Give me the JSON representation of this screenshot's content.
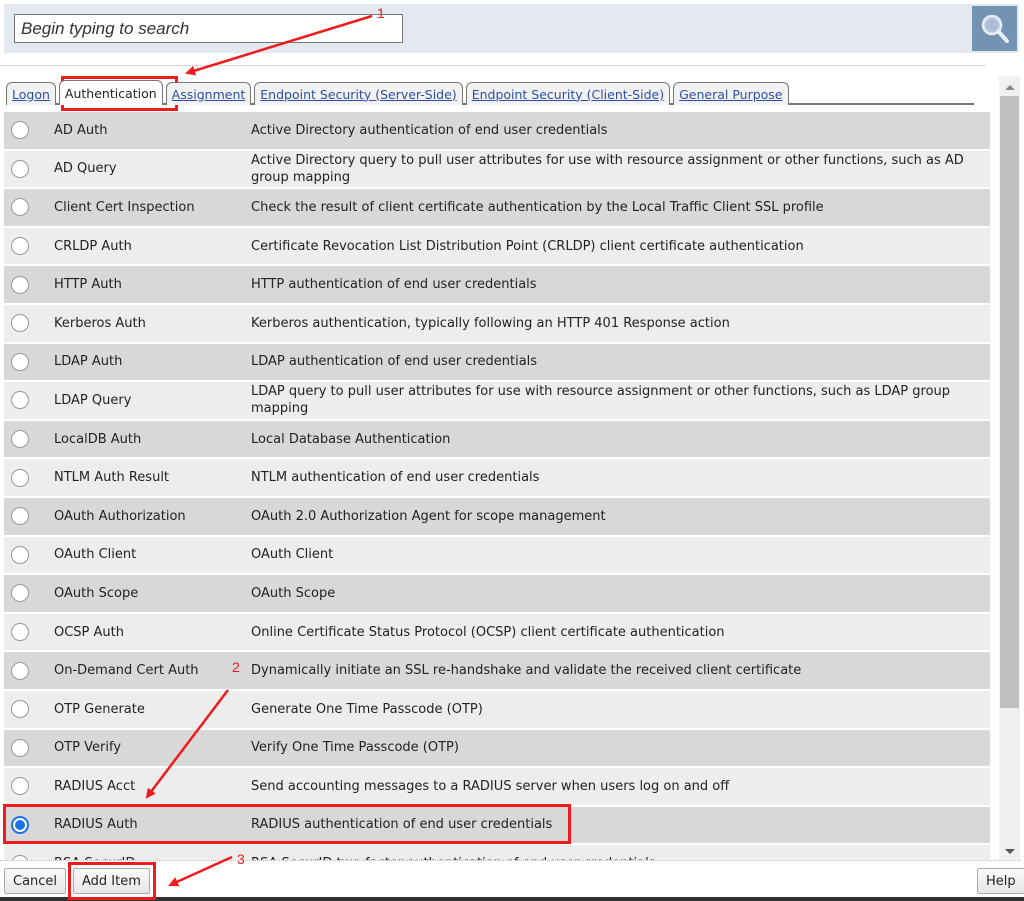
{
  "search": {
    "placeholder": "Begin typing to search",
    "value": "",
    "button_icon": "magnifier-icon",
    "button_color": "#7393b3"
  },
  "tabs": [
    {
      "label": "Logon",
      "active": false
    },
    {
      "label": "Authentication",
      "active": true
    },
    {
      "label": "Assignment",
      "active": false
    },
    {
      "label": "Endpoint Security (Server-Side)",
      "active": false
    },
    {
      "label": "Endpoint Security (Client-Side)",
      "active": false
    },
    {
      "label": "General Purpose",
      "active": false
    }
  ],
  "items": [
    {
      "name": "AD Auth",
      "description": "Active Directory authentication of end user credentials",
      "selected": false
    },
    {
      "name": "AD Query",
      "description": "Active Directory query to pull user attributes for use with resource assignment or other functions, such as AD group mapping",
      "selected": false
    },
    {
      "name": "Client Cert Inspection",
      "description": "Check the result of client certificate authentication by the Local Traffic Client SSL profile",
      "selected": false
    },
    {
      "name": "CRLDP Auth",
      "description": "Certificate Revocation List Distribution Point (CRLDP) client certificate authentication",
      "selected": false
    },
    {
      "name": "HTTP Auth",
      "description": "HTTP authentication of end user credentials",
      "selected": false
    },
    {
      "name": "Kerberos Auth",
      "description": "Kerberos authentication, typically following an HTTP 401 Response action",
      "selected": false
    },
    {
      "name": "LDAP Auth",
      "description": "LDAP authentication of end user credentials",
      "selected": false
    },
    {
      "name": "LDAP Query",
      "description": "LDAP query to pull user attributes for use with resource assignment or other functions, such as LDAP group mapping",
      "selected": false
    },
    {
      "name": "LocalDB Auth",
      "description": "Local Database Authentication",
      "selected": false
    },
    {
      "name": "NTLM Auth Result",
      "description": "NTLM authentication of end user credentials",
      "selected": false
    },
    {
      "name": "OAuth Authorization",
      "description": "OAuth 2.0 Authorization Agent for scope management",
      "selected": false
    },
    {
      "name": "OAuth Client",
      "description": "OAuth Client",
      "selected": false
    },
    {
      "name": "OAuth Scope",
      "description": "OAuth Scope",
      "selected": false
    },
    {
      "name": "OCSP Auth",
      "description": "Online Certificate Status Protocol (OCSP) client certificate authentication",
      "selected": false
    },
    {
      "name": "On-Demand Cert Auth",
      "description": "Dynamically initiate an SSL re-handshake and validate the received client certificate",
      "selected": false
    },
    {
      "name": "OTP Generate",
      "description": "Generate One Time Passcode (OTP)",
      "selected": false
    },
    {
      "name": "OTP Verify",
      "description": "Verify One Time Passcode (OTP)",
      "selected": false
    },
    {
      "name": "RADIUS Acct",
      "description": "Send accounting messages to a RADIUS server when users log on and off",
      "selected": false
    },
    {
      "name": "RADIUS Auth",
      "description": "RADIUS authentication of end user credentials",
      "selected": true
    },
    {
      "name": "RSA SecurID",
      "description": "RSA SecurID two-factor authentication of end user credentials",
      "selected": false
    }
  ],
  "buttons": {
    "cancel": "Cancel",
    "add_item": "Add Item",
    "help": "Help"
  },
  "annotations": {
    "color": "#ee1c1c",
    "labels": [
      "1",
      "2",
      "3"
    ]
  },
  "scroll": {
    "position_fraction": 0.0,
    "visible_fraction": 0.8
  }
}
